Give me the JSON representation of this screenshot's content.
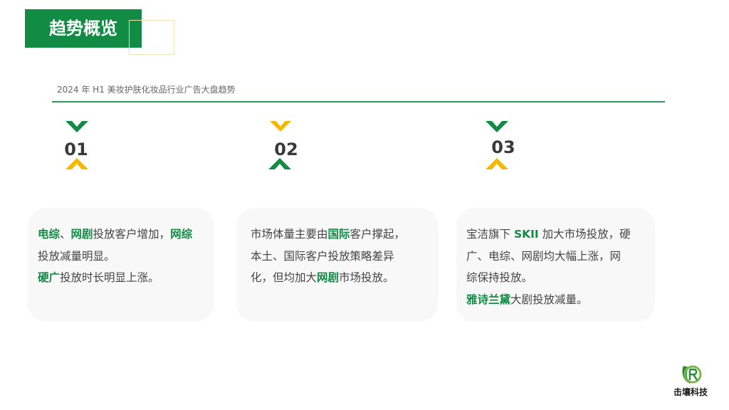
{
  "header": {
    "title": "趋势概览"
  },
  "subtitle": "2024 年 H1  美妆护肤化妆品行业广告大盘趋势",
  "colors": {
    "green": "#128b44",
    "yellow": "#f5b800",
    "text": "#444444"
  },
  "steps": [
    {
      "number": "01"
    },
    {
      "number": "02"
    },
    {
      "number": "03"
    }
  ],
  "cards": [
    {
      "lines": [
        [
          {
            "t": "电综",
            "hl": true
          },
          {
            "t": "、",
            "hl": false
          },
          {
            "t": "网剧",
            "hl": true
          },
          {
            "t": "投放客户增加，",
            "hl": false
          },
          {
            "t": "网综",
            "hl": true
          }
        ],
        [
          {
            "t": "投放减量明显。",
            "hl": false
          }
        ],
        [
          {
            "t": "硬广",
            "hl": true
          },
          {
            "t": "投放时长明显上涨。",
            "hl": false
          }
        ]
      ]
    },
    {
      "lines": [
        [
          {
            "t": "市场体量主要由",
            "hl": false
          },
          {
            "t": "国际",
            "hl": true
          },
          {
            "t": "客户撑起，",
            "hl": false
          }
        ],
        [
          {
            "t": "本土、国际客户投放策略差异",
            "hl": false
          }
        ],
        [
          {
            "t": "化，但均加大",
            "hl": false
          },
          {
            "t": "网剧",
            "hl": true
          },
          {
            "t": "市场投放。",
            "hl": false
          }
        ]
      ]
    },
    {
      "lines": [
        [
          {
            "t": "宝洁旗下 ",
            "hl": false
          },
          {
            "t": "SKII",
            "hl": true
          },
          {
            "t": " 加大市场投放，硬",
            "hl": false
          }
        ],
        [
          {
            "t": "广、电综、网剧均大幅上涨，网",
            "hl": false
          }
        ],
        [
          {
            "t": "综保持投放。",
            "hl": false
          }
        ],
        [
          {
            "t": "雅诗兰黛",
            "hl": true
          },
          {
            "t": "大剧投放减量。",
            "hl": false
          }
        ]
      ]
    }
  ],
  "logo": {
    "text": "击壤科技",
    "icon": "leaf-r-logo-icon"
  }
}
